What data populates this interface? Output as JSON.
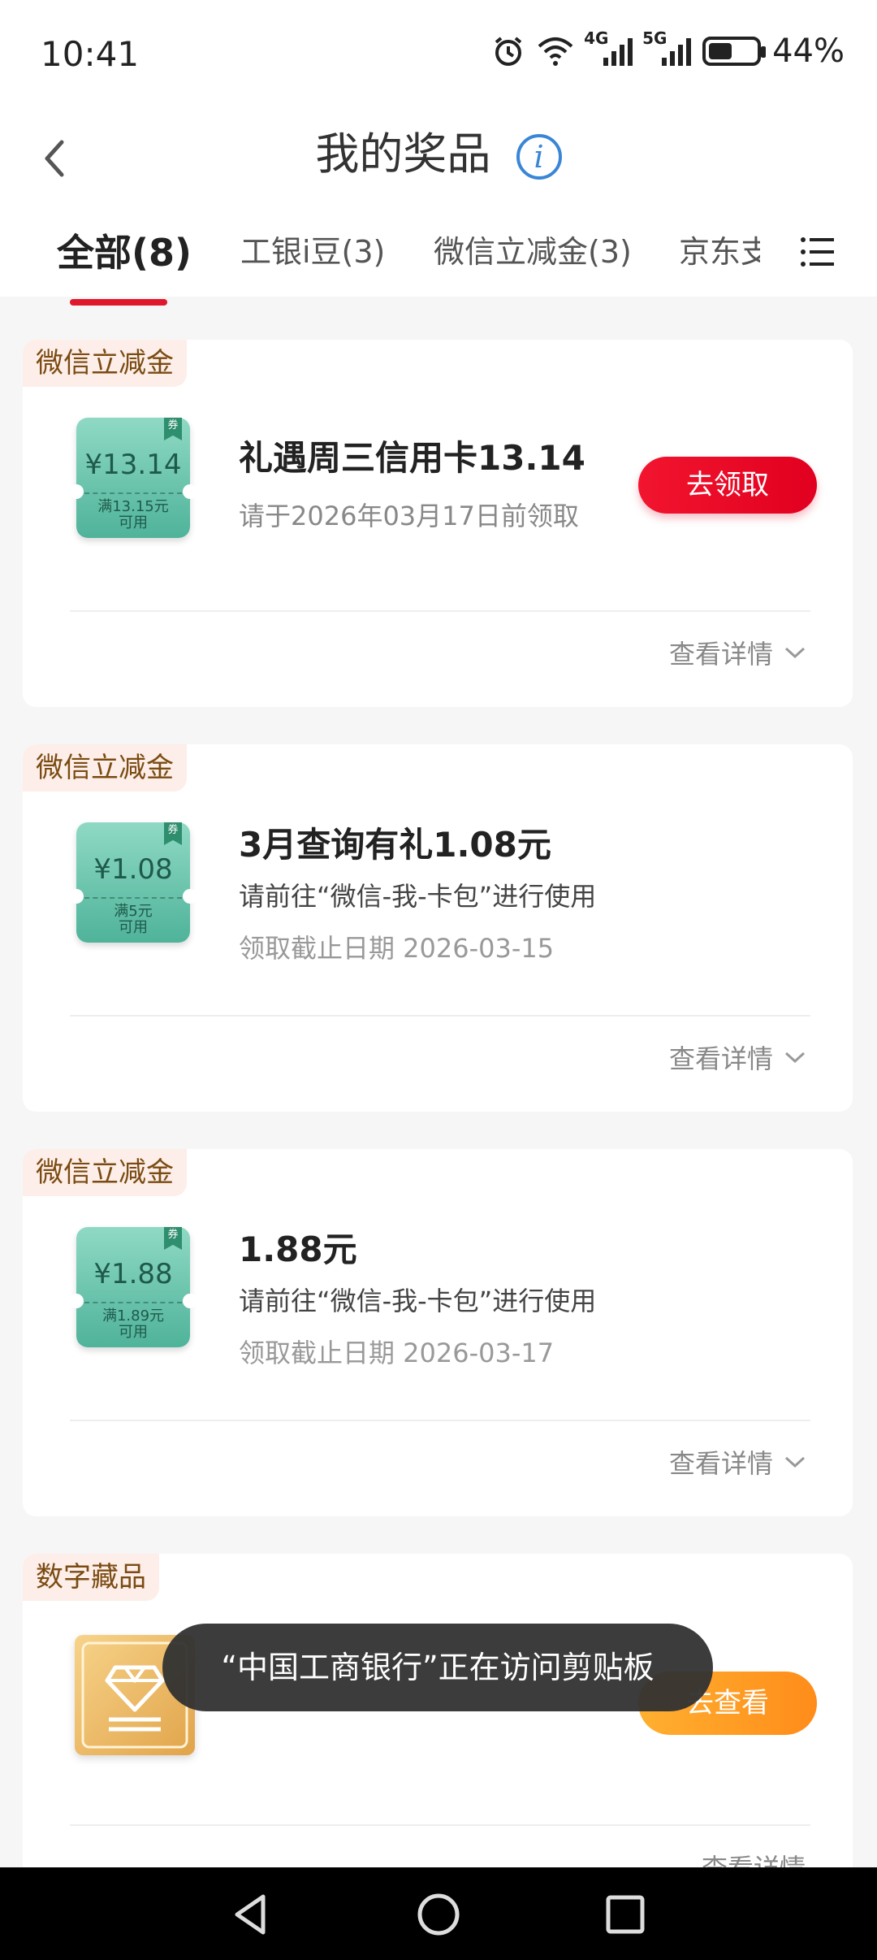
{
  "status_bar": {
    "time": "10:41",
    "network_4g": "4G",
    "network_5g": "5G",
    "battery": "44%"
  },
  "header": {
    "title": "我的奖品",
    "info_icon": "i"
  },
  "tabs": [
    {
      "label": "全部(8)",
      "active": true
    },
    {
      "label": "工银i豆(3)",
      "active": false
    },
    {
      "label": "微信立减金(3)",
      "active": false
    },
    {
      "label": "京东支",
      "active": false
    }
  ],
  "cards": [
    {
      "tag": "微信立减金",
      "coupon_amount": "¥13.14",
      "coupon_condition_1": "满13.15元",
      "coupon_condition_2": "可用",
      "coupon_badge": "券",
      "title": "礼遇周三信用卡13.14",
      "subtitle": "请于2026年03月17日前领取",
      "action": "去领取",
      "detail": "查看详情"
    },
    {
      "tag": "微信立减金",
      "coupon_amount": "¥1.08",
      "coupon_condition_1": "满5元",
      "coupon_condition_2": "可用",
      "coupon_badge": "券",
      "title": "3月查询有礼1.08元",
      "subtitle": "请前往“微信-我-卡包”进行使用",
      "date": "领取截止日期 2026-03-15",
      "detail": "查看详情"
    },
    {
      "tag": "微信立减金",
      "coupon_amount": "¥1.88",
      "coupon_condition_1": "满1.89元",
      "coupon_condition_2": "可用",
      "coupon_badge": "券",
      "title": "1.88元",
      "subtitle": "请前往“微信-我-卡包”进行使用",
      "date": "领取截止日期 2026-03-17",
      "detail": "查看详情"
    },
    {
      "tag": "数字藏品",
      "action": "去查看",
      "detail": "查看详情"
    }
  ],
  "toast": "“中国工商银行”正在访问剪贴板",
  "colors": {
    "accent_red": "#e1001f",
    "tag_bg": "#fdeee9",
    "tag_text": "#7a4b12",
    "coupon_green": "#4fb39a",
    "orange": "#ff8c1a"
  },
  "icons": {
    "back": "back-chevron-icon",
    "info": "info-icon",
    "menu": "list-menu-icon",
    "expand": "chevron-down-icon",
    "alarm": "alarm-icon",
    "wifi": "wifi-icon",
    "nav_back": "nav-back-icon",
    "nav_home": "nav-home-icon",
    "nav_recents": "nav-recents-icon"
  }
}
